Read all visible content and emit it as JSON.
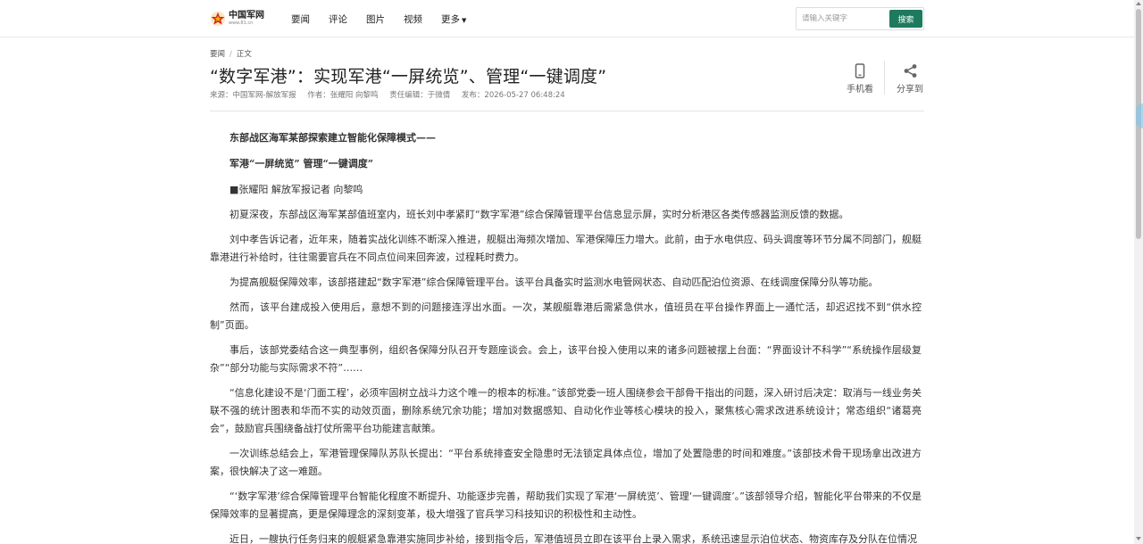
{
  "header": {
    "logo_name": "中国军网",
    "logo_url": "www.81.cn",
    "nav": [
      {
        "label": "要闻"
      },
      {
        "label": "评论"
      },
      {
        "label": "图片"
      },
      {
        "label": "视频"
      },
      {
        "label": "更多"
      }
    ],
    "search_placeholder": "请输入关键字",
    "search_button": "搜索"
  },
  "breadcrumb": [
    "要闻",
    "正文"
  ],
  "article": {
    "title": "“数字军港”：实现军港“一屏统览”、管理“一键调度”",
    "meta": {
      "source": "来源：中国军网-解放军报",
      "author": "作者：张耀阳 向黎鸣",
      "editor": "责任编辑：于微倩",
      "published": "发布：2026-05-27 06:48:24"
    },
    "tools": {
      "mobile_label": "手机看",
      "share_label": "分享到"
    },
    "paragraphs": [
      {
        "text": "东部战区海军某部探索建立智能化保障模式——",
        "style": "bold"
      },
      {
        "text": "军港“一屏统览” 管理“一键调度”",
        "style": "bold"
      },
      {
        "text": "■张耀阳 解放军报记者 向黎鸣",
        "style": "normal"
      },
      {
        "text": "初夏深夜，东部战区海军某部值班室内，班长刘中孝紧盯“数字军港”综合保障管理平台信息显示屏，实时分析港区各类传感器监测反馈的数据。",
        "style": "normal"
      },
      {
        "text": "刘中孝告诉记者，近年来，随着实战化训练不断深入推进，舰艇出海频次增加、军港保障压力增大。此前，由于水电供应、码头调度等环节分属不同部门，舰艇靠港进行补给时，往往需要官兵在不同点位间来回奔波，过程耗时费力。",
        "style": "normal"
      },
      {
        "text": "为提高舰艇保障效率，该部搭建起“数字军港”综合保障管理平台。该平台具备实时监测水电管网状态、自动匹配泊位资源、在线调度保障分队等功能。",
        "style": "normal"
      },
      {
        "text": "然而，该平台建成投入使用后，意想不到的问题接连浮出水面。一次，某舰艇靠港后需紧急供水，值班员在平台操作界面上一通忙活，却迟迟找不到“供水控制”页面。",
        "style": "normal"
      },
      {
        "text": "事后，该部党委结合这一典型事例，组织各保障分队召开专题座谈会。会上，该平台投入使用以来的诸多问题被摆上台面：“界面设计不科学”“系统操作层级复杂”“部分功能与实际需求不符”……",
        "style": "normal"
      },
      {
        "text": "“信息化建设不是‘门面工程’，必须牢固树立战斗力这个唯一的根本的标准。”该部党委一班人围绕参会干部骨干指出的问题，深入研讨后决定：取消与一线业务关联不强的统计图表和华而不实的动效页面，删除系统冗余功能；增加对数据感知、自动化作业等核心模块的投入，聚焦核心需求改进系统设计；常态组织“诸葛亮会”，鼓励官兵围绕备战打仗所需平台功能建言献策。",
        "style": "normal"
      },
      {
        "text": "一次训练总结会上，军港管理保障队苏队长提出：“平台系统排查安全隐患时无法锁定具体点位，增加了处置隐患的时间和难度。”该部技术骨干现场拿出改进方案，很快解决了这一难题。",
        "style": "normal"
      },
      {
        "text": "“‘数字军港’综合保障管理平台智能化程度不断提升、功能逐步完善，帮助我们实现了军港‘一屏统览’、管理‘一键调度’。”该部领导介绍，智能化平台带来的不仅是保障效率的显著提高，更是保障理念的深刻变革，极大增强了官兵学习科技知识的积极性和主动性。",
        "style": "normal"
      },
      {
        "text": "近日，一艘执行任务归来的舰艇紧急靠港实施同步补给，接到指令后，军港值班员立即在该平台上录入需求，系统迅速显示泊位状态、物资库存及分队在位情况",
        "style": "normal"
      }
    ]
  },
  "colors": {
    "accent": "#1e7a5e",
    "logo_red": "#d7261e",
    "logo_gold": "#f0b400"
  },
  "icons": {
    "logo": "star-badge-icon",
    "mobile": "mobile-phone-icon",
    "share": "share-icon",
    "nav_more": "caret-down-icon"
  }
}
